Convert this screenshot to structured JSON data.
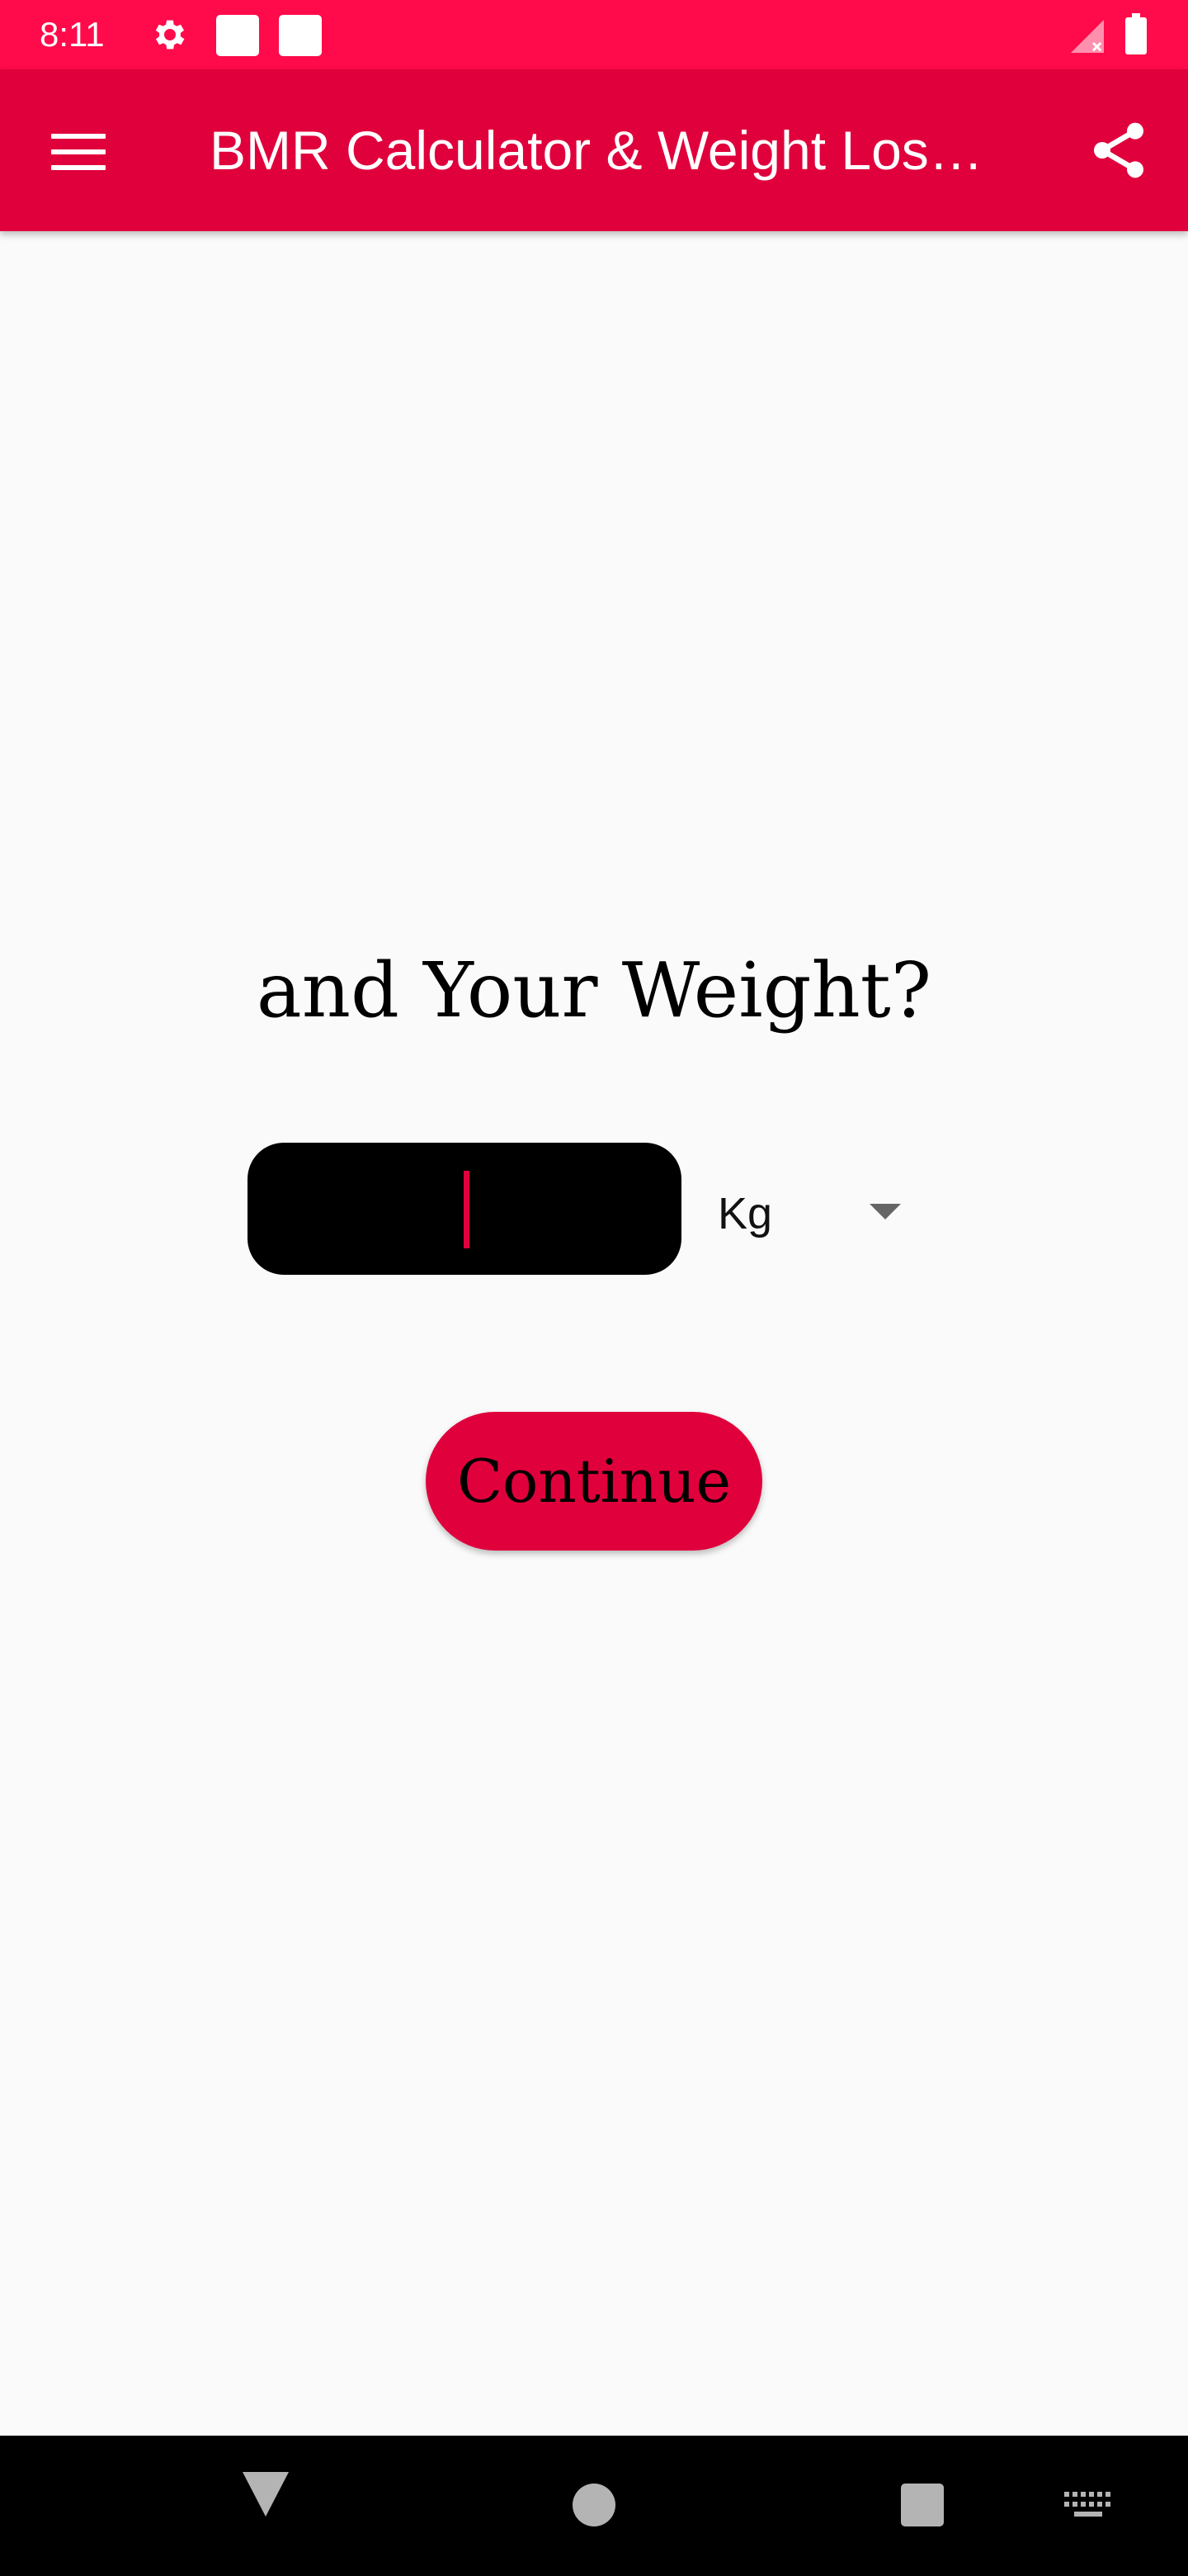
{
  "status_bar": {
    "time": "8:11",
    "background_color": "#ff0a4a",
    "icons": [
      "gear-icon",
      "notification-square-icon",
      "notification-square-icon",
      "signal-no-data-icon",
      "battery-icon"
    ]
  },
  "app_bar": {
    "title": "BMR Calculator & Weight Los…",
    "background_color": "#e0003c",
    "menu_icon": "hamburger-menu-icon",
    "share_icon": "share-icon"
  },
  "main": {
    "question": "and Your Weight?",
    "weight_input": {
      "value": "",
      "placeholder": ""
    },
    "unit_select": {
      "selected": "Kg",
      "icon": "dropdown-arrow-icon"
    },
    "continue_label": "Continue",
    "accent_color": "#e0003c"
  },
  "nav_bar": {
    "icons": [
      "back-icon",
      "home-icon",
      "recents-icon",
      "keyboard-icon"
    ]
  }
}
